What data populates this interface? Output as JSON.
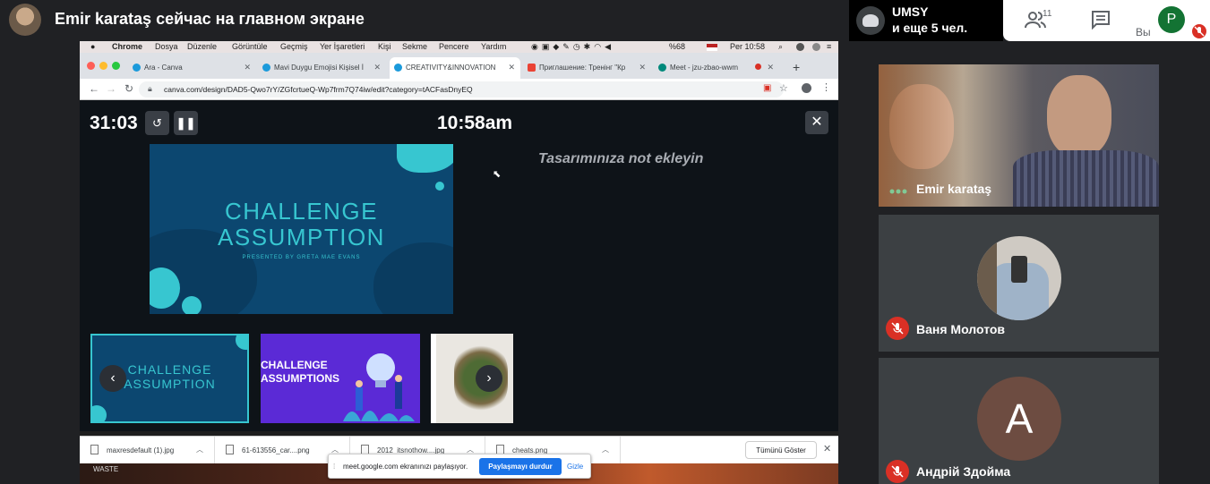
{
  "meeting": {
    "presenter_banner": "Emir karataş сейчас на главном экране",
    "pinned_participant": "UMSY",
    "others_count": "и еще 5 чел.",
    "people_count": "11",
    "self_initial": "P",
    "self_label": "Вы"
  },
  "mac_menubar": {
    "items": [
      "Chrome",
      "Dosya",
      "Düzenle",
      "Görüntüle",
      "Geçmiş",
      "Yer İşaretleri",
      "Kişi",
      "Sekme",
      "Pencere",
      "Yardım"
    ],
    "battery": "%68",
    "clock": "Per 10:58"
  },
  "browser": {
    "tabs": [
      {
        "title": "Ara - Canva"
      },
      {
        "title": "Mavi Duygu Emojisi Kişisel İ"
      },
      {
        "title": "CREATIVITY&INNOVATION"
      },
      {
        "title": "Приглашение: Тренінг \"Кр"
      },
      {
        "title": "Meet - jzu-zbao-wwm"
      }
    ],
    "active_tab_index": 2,
    "url": "canva.com/design/DAD5-Qwo7rY/ZGfcrtueQ-Wp7frm7Q74iw/edit?category=tACFasDnyEQ"
  },
  "canva_presenter": {
    "timer": "31:03",
    "clock": "10:58am",
    "notes_placeholder": "Tasarımınıza not ekleyin",
    "slide_title_line1": "CHALLENGE",
    "slide_title_line2": "ASSUMPTION",
    "slide_subtitle": "PRESENTED BY GRETA MAE EVANS",
    "thumb1_line1": "CHALLENGE",
    "thumb1_line2": "ASSUMPTION",
    "thumb2_line1": "CHALLENGE",
    "thumb2_line2": "ASSUMPTIONS"
  },
  "downloads": {
    "items": [
      {
        "name": "maxresdefault (1).jpg"
      },
      {
        "name": "61-613556_car....png"
      },
      {
        "name": "2012_itsnothow....jpg"
      },
      {
        "name": "cheats.png"
      }
    ],
    "show_all": "Tümünü Göster"
  },
  "desktop": {
    "label": "WASTE"
  },
  "share_bar": {
    "text": "meet.google.com ekranınızı paylaşıyor.",
    "stop_label": "Paylaşmayı durdur",
    "hide_label": "Gizle"
  },
  "participants": [
    {
      "name": "Emir karataş",
      "muted": false
    },
    {
      "name": "Ваня Молотов",
      "muted": true
    },
    {
      "name": "Андрій Здойма",
      "muted": true,
      "initial": "A"
    }
  ],
  "colors": {
    "meet_bg": "#202124",
    "canva_teal": "#37c6d0",
    "slide_blue": "#0c4770",
    "stop_share_blue": "#1a73e8",
    "muted_red": "#d93025",
    "avatar_brown": "#6d4c41"
  }
}
